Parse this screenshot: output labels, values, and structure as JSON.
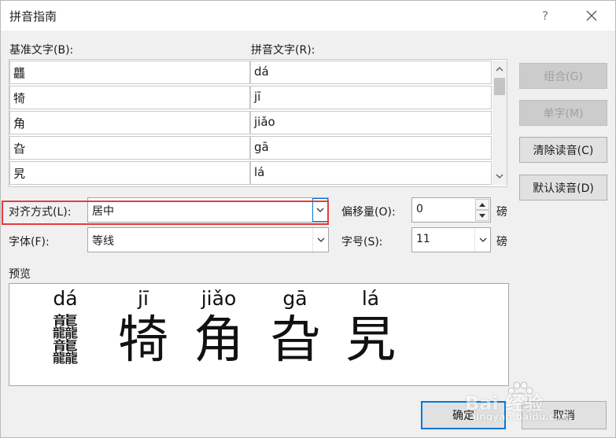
{
  "window": {
    "title": "拼音指南",
    "help": "?"
  },
  "grid": {
    "base_label": "基准文字(B):",
    "pinyin_label": "拼音文字(R):",
    "rows": [
      {
        "base": "龘",
        "pinyin": "dá"
      },
      {
        "base": "犄",
        "pinyin": "jī"
      },
      {
        "base": "角",
        "pinyin": "jiǎo"
      },
      {
        "base": "旮",
        "pinyin": "gā"
      },
      {
        "base": "旯",
        "pinyin": "lá"
      }
    ]
  },
  "buttons": {
    "combine": "组合(G)",
    "single": "单字(M)",
    "clear": "清除读音(C)",
    "default_reading": "默认读音(D)",
    "ok": "确定",
    "cancel": "取消"
  },
  "alignment": {
    "label": "对齐方式(L):",
    "value": "居中"
  },
  "font": {
    "label": "字体(F):",
    "value": "等线"
  },
  "offset": {
    "label": "偏移量(O):",
    "value": "0",
    "unit": "磅"
  },
  "size": {
    "label": "字号(S):",
    "value": "11",
    "unit": "磅"
  },
  "preview": {
    "label": "预览",
    "items": [
      {
        "pinyin": "dá",
        "char": "龘"
      },
      {
        "pinyin": "jī",
        "char": "犄"
      },
      {
        "pinyin": "jiǎo",
        "char": "角"
      },
      {
        "pinyin": "gā",
        "char": "旮"
      },
      {
        "pinyin": "lá",
        "char": "旯"
      }
    ]
  },
  "watermark": {
    "logo": "Bai 经验",
    "url": "jingyan.baidu.com"
  },
  "colors": {
    "highlight": "#e33d3d",
    "accent": "#0078d7"
  }
}
